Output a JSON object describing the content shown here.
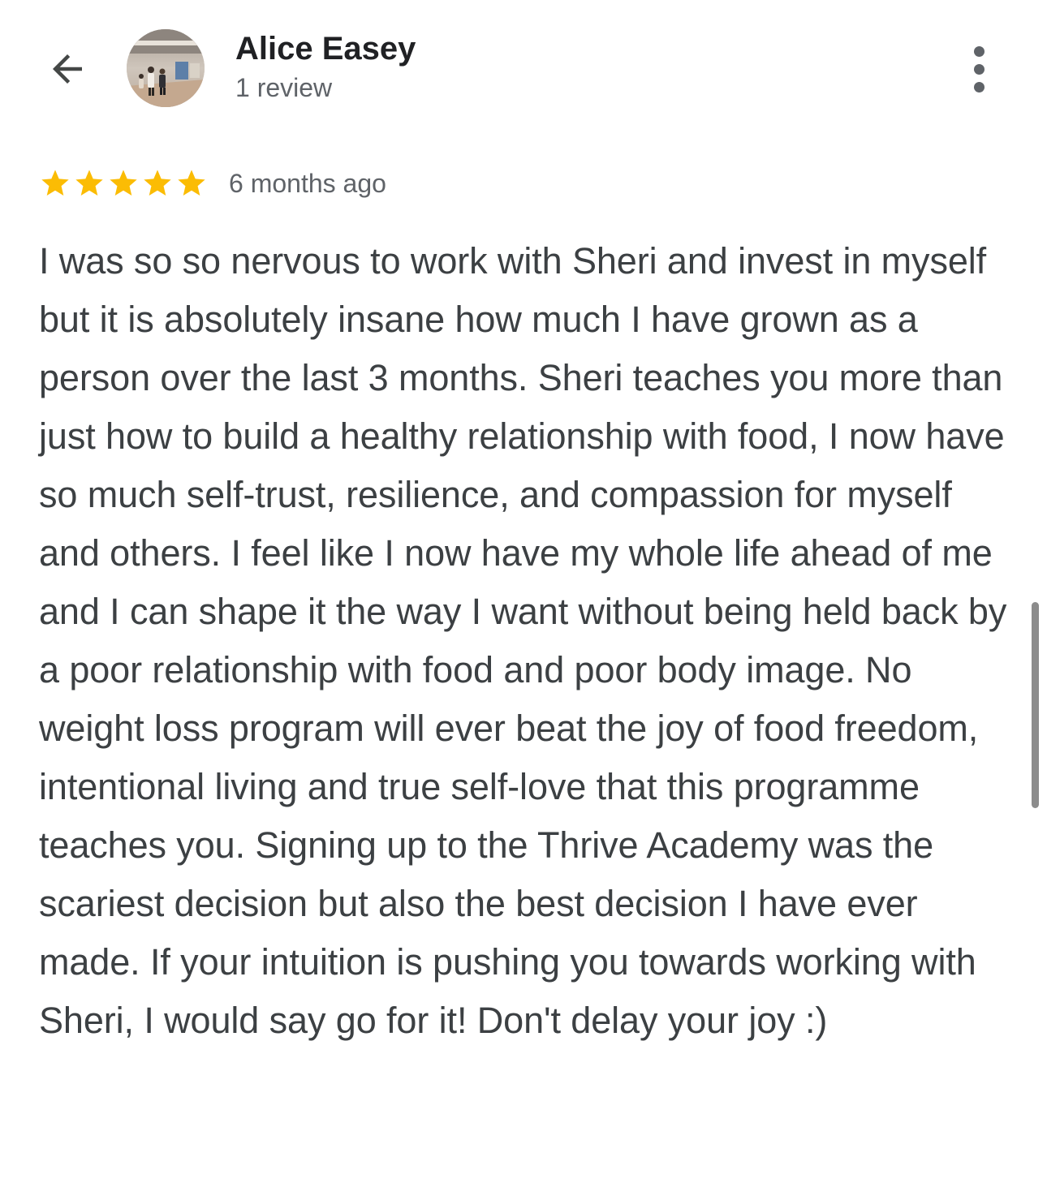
{
  "header": {
    "back_icon": "arrow-back-icon",
    "reviewer_name": "Alice Easey",
    "review_count": "1 review",
    "more_icon": "more-vertical-icon"
  },
  "review": {
    "rating": 5,
    "rating_max": 5,
    "star_color": "#fbbc04",
    "time": "6 months ago",
    "text": "I was so so nervous to work with Sheri and invest in myself but it is absolutely insane how much I have grown as a person over the last 3 months. Sheri teaches you more than just how to build a healthy relationship with food, I now have so much self-trust, resilience, and compassion for myself and others. I feel like I now have my whole life ahead of me and I can shape it the way I want without being held back by a poor relationship with food and poor body image. No weight loss program will ever beat the joy of food freedom, intentional living and true self-love that this programme teaches you. Signing up to the Thrive Academy was the scariest decision but also the best decision I have ever made. If your intuition is pushing you towards working with Sheri, I would say go for it! Don't delay your joy :)"
  }
}
